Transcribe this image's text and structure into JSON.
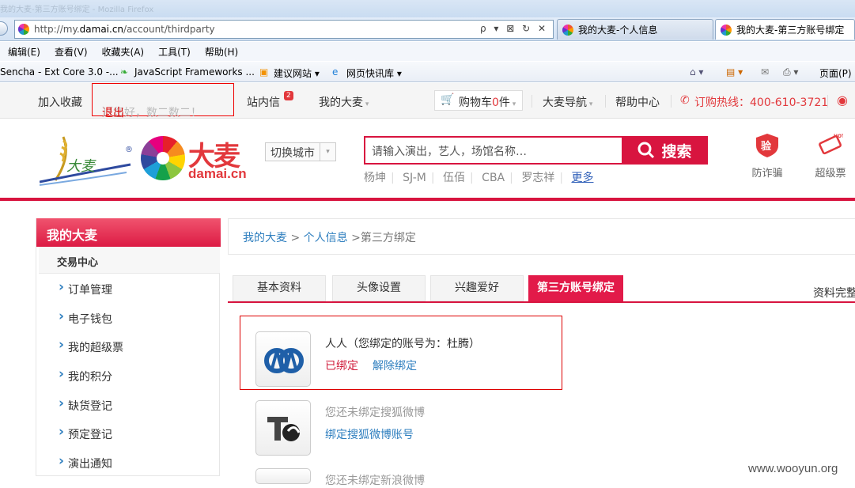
{
  "browser": {
    "title_faded": "我的大麦-第三方账号绑定 - Mozilla Firefox",
    "url_prefix": "http://my.",
    "url_domain": "damai.cn",
    "url_path": "/account/thirdparty",
    "address_controls": "ρ ▾ ⊠ ↻ ✕",
    "tabs": [
      {
        "label": "我的大麦-个人信息"
      },
      {
        "label": "我的大麦-第三方账号绑定"
      }
    ],
    "menu": [
      "编辑(E)",
      "查看(V)",
      "收藏夹(A)",
      "工具(T)",
      "帮助(H)"
    ],
    "favorites": [
      "Sencha - Ext Core 3.0 -...",
      "JavaScript Frameworks ...",
      "建议网站 ▾",
      "网页快讯库 ▾"
    ],
    "page_menu": "页面(P)"
  },
  "topnav": {
    "add_favorite": "加入收藏",
    "greeting": "〔您好，数二数二！",
    "logout": "退出",
    "greeting_close": "〕",
    "messages": "站内信",
    "messages_count": "2",
    "my_damai": "我的大麦",
    "cart": "购物车",
    "cart_count": "0",
    "cart_unit": "件",
    "nav": "大麦导航",
    "help": "帮助中心",
    "hotline": "订购热线：400-610-3721"
  },
  "header": {
    "brand_cn": "大麦",
    "brand_en": "damai.cn",
    "city_switch": "切换城市",
    "search_placeholder": "请输入演出，艺人，场馆名称…",
    "search_button": "搜索",
    "hot_words": [
      "杨坤",
      "SJ-M",
      "伍佰",
      "CBA",
      "罗志祥"
    ],
    "more": "更多",
    "services": [
      {
        "label": "防诈骗",
        "icon": "shield-verify-icon"
      },
      {
        "label": "超级票",
        "icon": "hot-ticket-icon"
      }
    ]
  },
  "sidebar": {
    "title": "我的大麦",
    "group": "交易中心",
    "items": [
      "订单管理",
      "电子钱包",
      "我的超级票",
      "我的积分",
      "缺货登记",
      "预定登记",
      "演出通知"
    ]
  },
  "breadcrumb": {
    "root": "我的大麦",
    "sep1": " > ",
    "mid": "个人信息",
    "current": " >第三方绑定"
  },
  "tabs": [
    {
      "label": "基本资料",
      "active": false
    },
    {
      "label": "头像设置",
      "active": false
    },
    {
      "label": "兴趣爱好",
      "active": false
    },
    {
      "label": "第三方账号绑定",
      "active": true
    }
  ],
  "completeness": "资料完整",
  "bindings": [
    {
      "name": "人人（您绑定的账号为：杜腾）",
      "status": "已绑定",
      "action": "解除绑定",
      "icon": "renren-logo-icon"
    },
    {
      "name": "您还未绑定搜狐微博",
      "action": "绑定搜狐微博账号",
      "icon": "sohu-weibo-logo-icon"
    },
    {
      "name": "您还未绑定新浪微博"
    }
  ],
  "watermark": "www.wooyun.org"
}
